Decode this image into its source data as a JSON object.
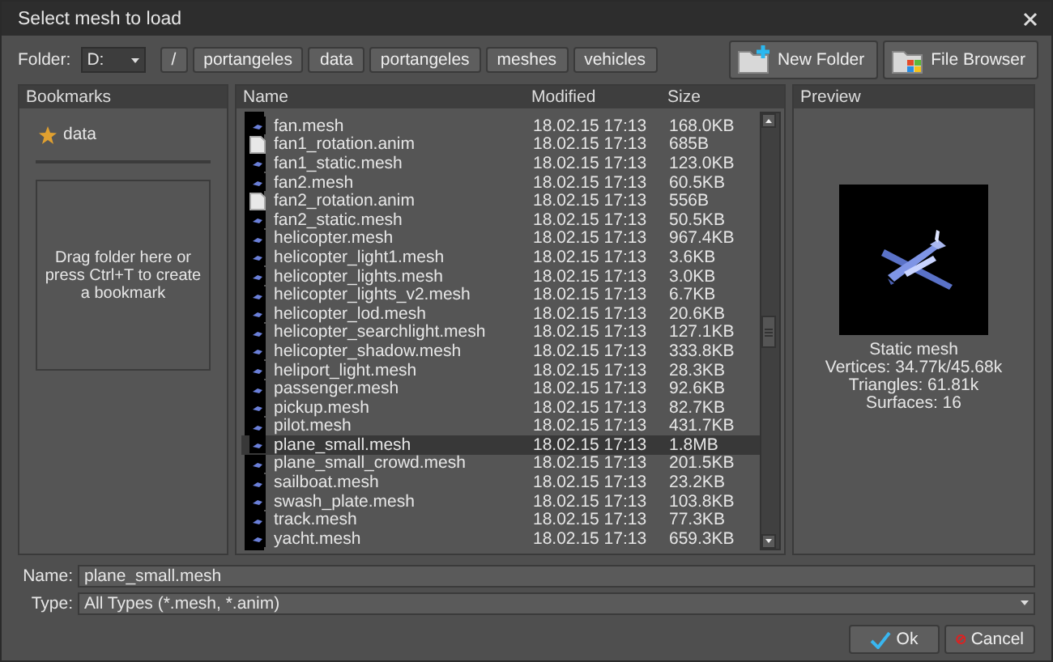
{
  "window": {
    "title": "Select mesh to load"
  },
  "folder": {
    "label": "Folder:",
    "drive": "D:",
    "path": [
      "/",
      "portangeles",
      "data",
      "portangeles",
      "meshes",
      "vehicles"
    ]
  },
  "toolbar": [
    {
      "label": "New Folder",
      "kind": "new-folder"
    },
    {
      "label": "File Browser",
      "kind": "file-browser"
    }
  ],
  "bookmarks": {
    "title": "Bookmarks",
    "items": [
      {
        "label": "data"
      }
    ],
    "hint": "Drag folder here or press Ctrl+T to create a bookmark"
  },
  "files": {
    "columns": [
      "Name",
      "Modified",
      "Size"
    ],
    "rows": [
      {
        "name": "fan.mesh",
        "modified": "18.02.15 17:13",
        "size": "168.0KB",
        "kind": "mesh",
        "selected": false
      },
      {
        "name": "fan1_rotation.anim",
        "modified": "18.02.15 17:13",
        "size": "685B",
        "kind": "anim",
        "selected": false
      },
      {
        "name": "fan1_static.mesh",
        "modified": "18.02.15 17:13",
        "size": "123.0KB",
        "kind": "mesh",
        "selected": false
      },
      {
        "name": "fan2.mesh",
        "modified": "18.02.15 17:13",
        "size": "60.5KB",
        "kind": "mesh",
        "selected": false
      },
      {
        "name": "fan2_rotation.anim",
        "modified": "18.02.15 17:13",
        "size": "556B",
        "kind": "anim",
        "selected": false
      },
      {
        "name": "fan2_static.mesh",
        "modified": "18.02.15 17:13",
        "size": "50.5KB",
        "kind": "mesh",
        "selected": false
      },
      {
        "name": "helicopter.mesh",
        "modified": "18.02.15 17:13",
        "size": "967.4KB",
        "kind": "mesh",
        "selected": false
      },
      {
        "name": "helicopter_light1.mesh",
        "modified": "18.02.15 17:13",
        "size": "3.6KB",
        "kind": "mesh",
        "selected": false
      },
      {
        "name": "helicopter_lights.mesh",
        "modified": "18.02.15 17:13",
        "size": "3.0KB",
        "kind": "mesh",
        "selected": false
      },
      {
        "name": "helicopter_lights_v2.mesh",
        "modified": "18.02.15 17:13",
        "size": "6.7KB",
        "kind": "mesh",
        "selected": false
      },
      {
        "name": "helicopter_lod.mesh",
        "modified": "18.02.15 17:13",
        "size": "20.6KB",
        "kind": "mesh",
        "selected": false
      },
      {
        "name": "helicopter_searchlight.mesh",
        "modified": "18.02.15 17:13",
        "size": "127.1KB",
        "kind": "mesh",
        "selected": false
      },
      {
        "name": "helicopter_shadow.mesh",
        "modified": "18.02.15 17:13",
        "size": "333.8KB",
        "kind": "mesh",
        "selected": false
      },
      {
        "name": "heliport_light.mesh",
        "modified": "18.02.15 17:13",
        "size": "28.3KB",
        "kind": "mesh",
        "selected": false
      },
      {
        "name": "passenger.mesh",
        "modified": "18.02.15 17:13",
        "size": "92.6KB",
        "kind": "mesh",
        "selected": false
      },
      {
        "name": "pickup.mesh",
        "modified": "18.02.15 17:13",
        "size": "82.7KB",
        "kind": "mesh",
        "selected": false
      },
      {
        "name": "pilot.mesh",
        "modified": "18.02.15 17:13",
        "size": "431.7KB",
        "kind": "mesh",
        "selected": false
      },
      {
        "name": "plane_small.mesh",
        "modified": "18.02.15 17:13",
        "size": "1.8MB",
        "kind": "mesh",
        "selected": true
      },
      {
        "name": "plane_small_crowd.mesh",
        "modified": "18.02.15 17:13",
        "size": "201.5KB",
        "kind": "mesh",
        "selected": false
      },
      {
        "name": "sailboat.mesh",
        "modified": "18.02.15 17:13",
        "size": "23.2KB",
        "kind": "mesh",
        "selected": false
      },
      {
        "name": "swash_plate.mesh",
        "modified": "18.02.15 17:13",
        "size": "103.8KB",
        "kind": "mesh",
        "selected": false
      },
      {
        "name": "track.mesh",
        "modified": "18.02.15 17:13",
        "size": "77.3KB",
        "kind": "mesh",
        "selected": false
      },
      {
        "name": "yacht.mesh",
        "modified": "18.02.15 17:13",
        "size": "659.3KB",
        "kind": "mesh",
        "selected": false
      }
    ]
  },
  "preview": {
    "title": "Preview",
    "stats": [
      "Static mesh",
      "Vertices: 34.77k/45.68k",
      "Triangles: 61.81k",
      "Surfaces: 16"
    ]
  },
  "name_field": {
    "label": "Name:",
    "value": "plane_small.mesh"
  },
  "type_field": {
    "label": "Type:",
    "value": "All Types (*.mesh, *.anim)"
  },
  "buttons": [
    {
      "label": "Ok",
      "kind": "ok"
    },
    {
      "label": "Cancel",
      "kind": "cancel"
    }
  ]
}
